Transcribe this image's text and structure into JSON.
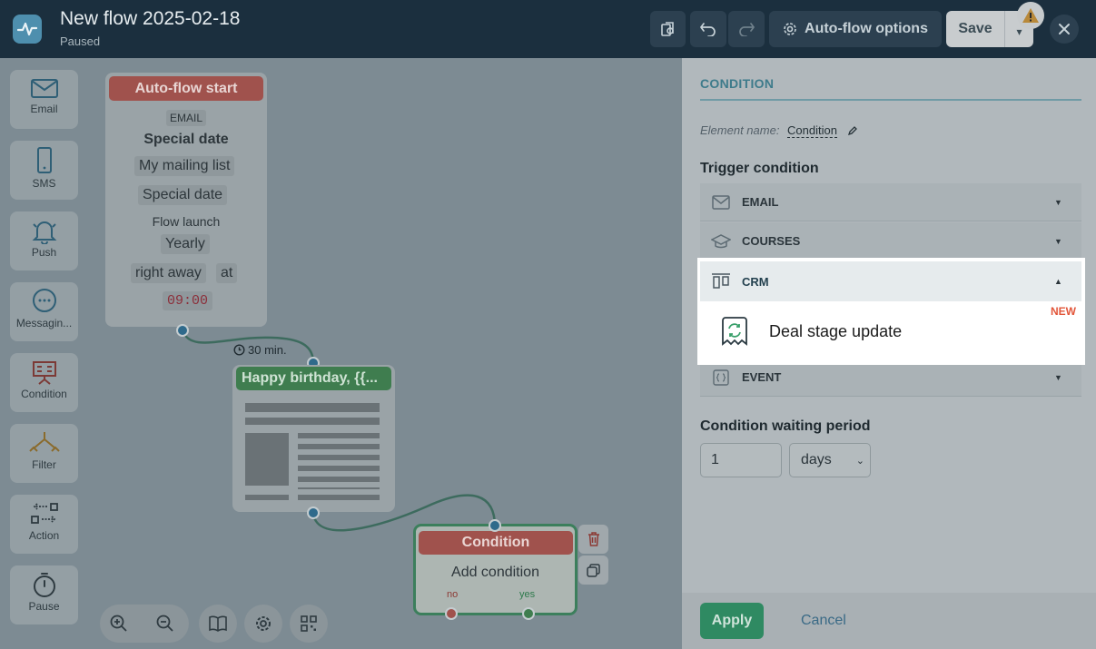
{
  "header": {
    "title": "New flow 2025-02-18",
    "status": "Paused",
    "auto_flow_options": "Auto-flow options",
    "save": "Save"
  },
  "toolbox": [
    "Email",
    "SMS",
    "Push",
    "Messagin...",
    "Condition",
    "Filter",
    "Action",
    "Pause"
  ],
  "canvas": {
    "start": {
      "header": "Auto-flow start",
      "badge": "EMAIL",
      "event": "Special date",
      "list": "My mailing list",
      "date_field": "Special date",
      "launch_label": "Flow launch",
      "frequency": "Yearly",
      "timing": "right away",
      "at": "at",
      "time": "09:00"
    },
    "delay": "30 min.",
    "email_node": {
      "header": "Happy birthday, {{..."
    },
    "condition_node": {
      "header": "Condition",
      "body": "Add condition",
      "no": "no",
      "yes": "yes"
    }
  },
  "panel": {
    "title": "CONDITION",
    "element_name_label": "Element name:",
    "element_name_value": "Condition",
    "trigger_title": "Trigger condition",
    "accordions": {
      "email": "EMAIL",
      "courses": "COURSES",
      "crm": "CRM",
      "event": "EVENT"
    },
    "crm_item": "Deal stage update",
    "new_badge": "NEW",
    "wait_title": "Condition waiting period",
    "wait_value": "1",
    "wait_unit": "days",
    "apply": "Apply",
    "cancel": "Cancel"
  },
  "colors": {
    "header_bg": "#1b2f3e",
    "start_red": "#a0524d",
    "email_green": "#3f7d4f",
    "apply_green": "#2f8a62",
    "new_orange": "#e2563a",
    "accent_teal": "#3e7b8b"
  }
}
